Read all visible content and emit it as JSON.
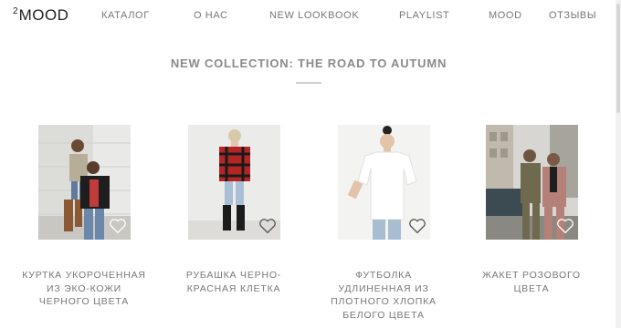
{
  "brand": {
    "superscript": "2",
    "wordmark": "MOOD"
  },
  "nav": {
    "items": [
      {
        "label": "КАТАЛОГ"
      },
      {
        "label": "О НАС"
      },
      {
        "label": "NEW LOOKBOOK"
      },
      {
        "label": "PLAYLIST"
      },
      {
        "label": "MOOD"
      },
      {
        "label": "ОТЗЫВЫ"
      }
    ]
  },
  "section": {
    "title": "NEW COLLECTION: THE ROAD TO AUTUMN"
  },
  "products": [
    {
      "name": "КУРТКА УКОРОЧЕННАЯ ИЗ ЭКО-КОЖИ ЧЕРНОГО ЦВЕТА",
      "icon": "heart-icon"
    },
    {
      "name": "РУБАШКА ЧЕРНО-КРАСНАЯ КЛЕТКА",
      "icon": "heart-icon"
    },
    {
      "name": "ФУТБОЛКА УДЛИНЕННАЯ ИЗ ПЛОТНОГО ХЛОПКА БЕЛОГО ЦВЕТА",
      "icon": "heart-icon"
    },
    {
      "name": "ЖАКЕТ РОЗОВОГО ЦВЕТА",
      "icon": "heart-icon"
    }
  ],
  "colors": {
    "text": "#777777",
    "logo": "#222222",
    "rule": "#cfcfcf"
  }
}
